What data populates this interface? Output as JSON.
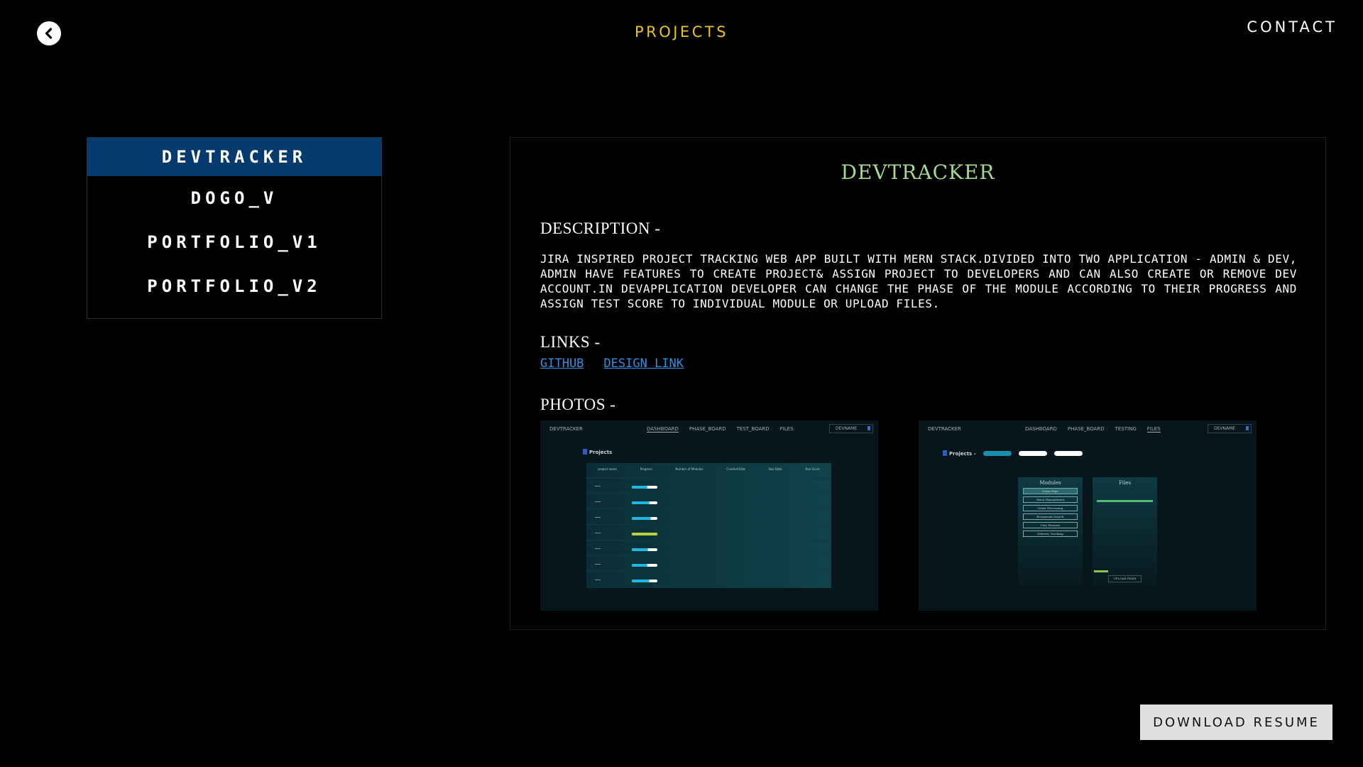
{
  "header": {
    "title": "PROJECTS",
    "contact_label": "CONTACT",
    "back_icon": "chevron-left-circle-icon"
  },
  "projects": {
    "items": [
      {
        "label": "DEVTRACKER",
        "active": true
      },
      {
        "label": "DOGO_V",
        "active": false
      },
      {
        "label": "PORTFOLIO_V1",
        "active": false
      },
      {
        "label": "PORTFOLIO_V2",
        "active": false
      }
    ]
  },
  "detail": {
    "title": "DEVTRACKER",
    "description_heading": "DESCRIPTION -",
    "description": "JIRA INSPIRED PROJECT TRACKING WEB APP BUILT WITH MERN STACK.DIVIDED INTO TWO APPLICATION - ADMIN & DEV, ADMIN HAVE FEATURES TO CREATE PROJECT& ASSIGN PROJECT TO DEVELOPERS AND CAN ALSO CREATE OR REMOVE DEV ACCOUNT.IN DEVAPPLICATION DEVELOPER CAN CHANGE THE PHASE OF THE MODULE ACCORDING TO THEIR PROGRESS AND ASSIGN TEST SCORE TO INDIVIDUAL MODULE OR UPLOAD FILES.",
    "links_heading": "LINKS -",
    "links": [
      "GITHUB",
      "DESIGN LINK"
    ],
    "photos_heading": "PHOTOS -"
  },
  "photo1": {
    "brand": "DEVTRACKER",
    "nav": [
      "DASHBOARD",
      "PHASE_BOARD",
      "TEST_BOARD",
      "FILES"
    ],
    "user": "DEVNAME",
    "title": "Projects",
    "columns": [
      "project name",
      "Progress",
      "Number of Modules",
      "Created Date",
      "Due Date",
      "Test Score"
    ],
    "progress": [
      0.6,
      0.7,
      0.75,
      1.0,
      0.65,
      0.6,
      0.7
    ],
    "accent": "#1fb8e0",
    "complete_color": "#b5d33a"
  },
  "photo2": {
    "brand": "DEVTRACKER",
    "nav": [
      "DASHBOARD",
      "PHASE_BOARD",
      "TESTING",
      "FILES"
    ],
    "user": "DEVNAME",
    "title": "Projects -",
    "modules_title": "Modules",
    "modules": [
      "Login Page",
      "Menu Management",
      "Order Processing",
      "Restaurant Search",
      "User Reviews",
      "Delivery Tracking"
    ],
    "files_title": "Files",
    "upload_label": "UPLOAD FILES"
  },
  "footer": {
    "download_label": "DOWNLOAD RESUME"
  }
}
